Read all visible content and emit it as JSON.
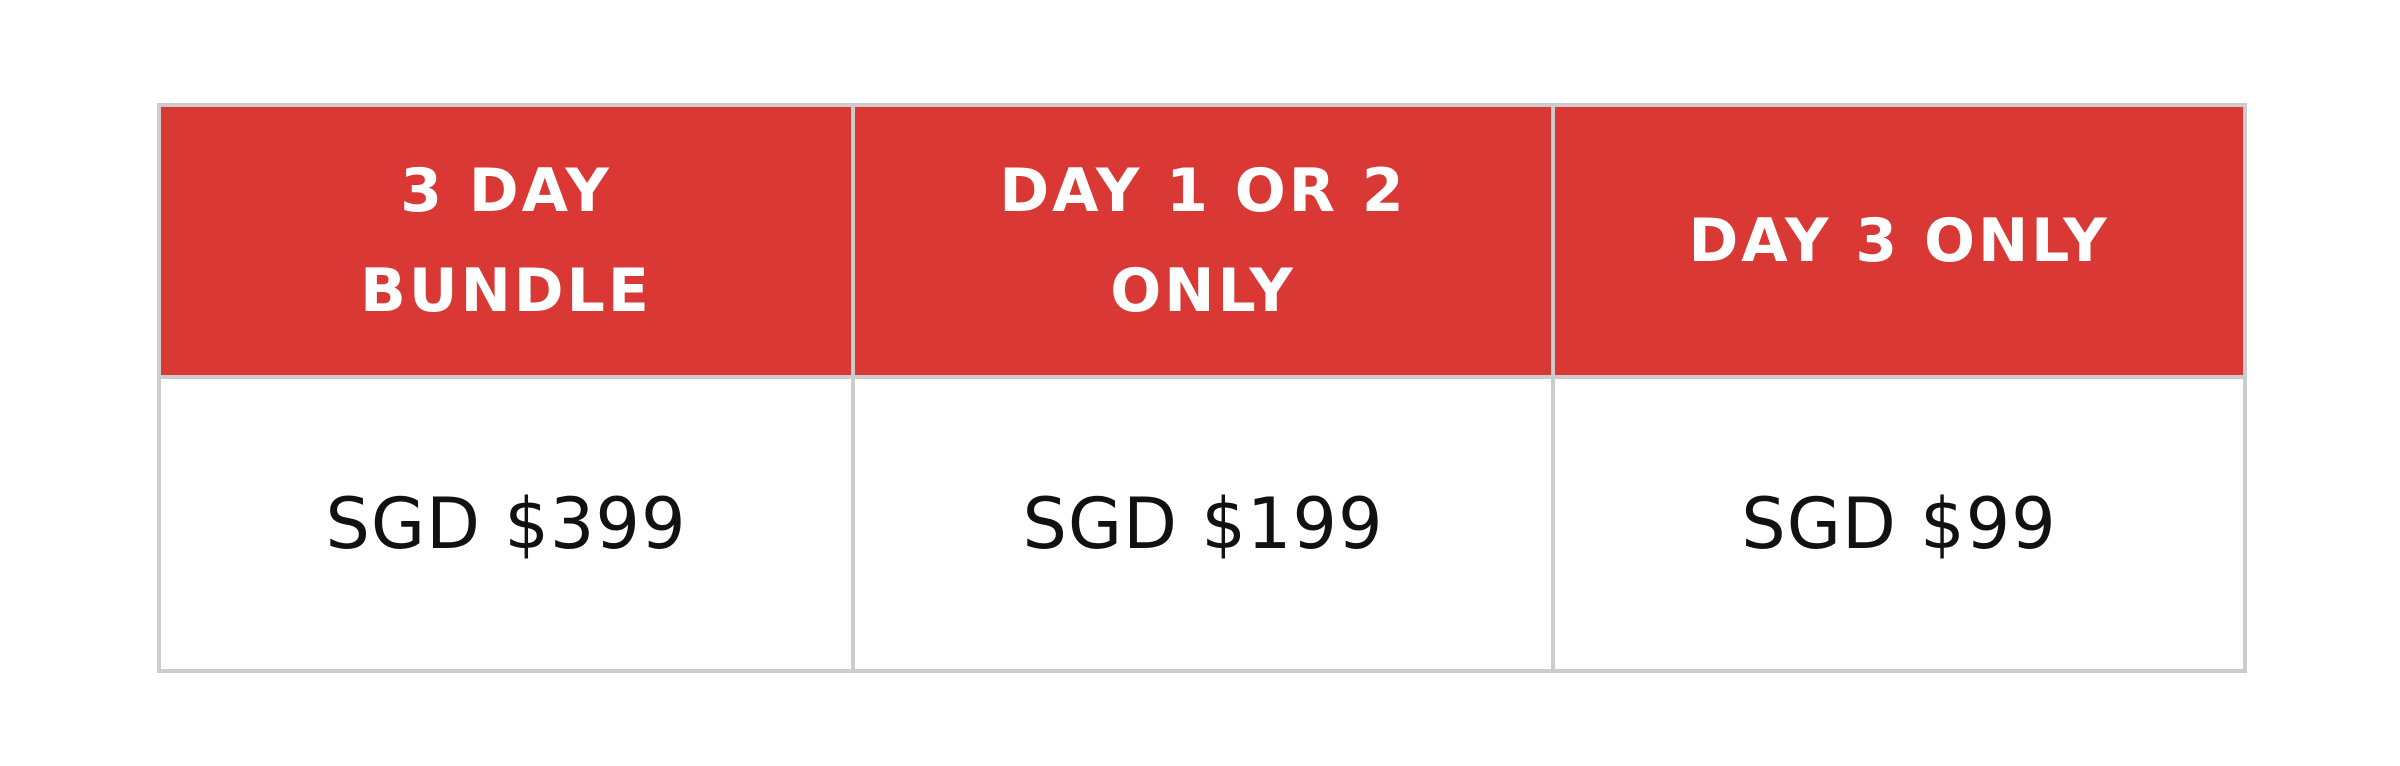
{
  "colors": {
    "header_background": "#d93834",
    "header_text": "#ffffff",
    "price_text": "#111111",
    "border": "#cccccc"
  },
  "pricing_table": {
    "headers": [
      "3 DAY BUNDLE",
      "DAY 1 OR 2 ONLY",
      "DAY 3 ONLY"
    ],
    "prices": [
      "SGD $399",
      "SGD $199",
      "SGD $99"
    ]
  }
}
